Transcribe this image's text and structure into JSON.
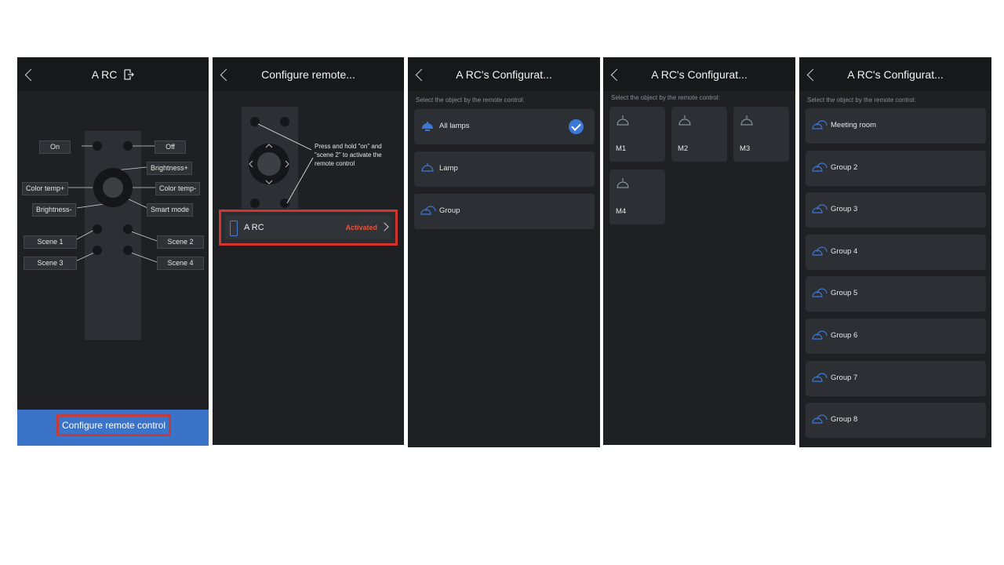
{
  "colors": {
    "accent": "#3a73c7",
    "highlight": "#d3352e",
    "activated": "#e4553e",
    "background": "#1e2023"
  },
  "screen1": {
    "title": "A RC",
    "title_icon": "exit-icon",
    "labels": {
      "on": "On",
      "off": "Off",
      "brightness_up": "Brightness+",
      "color_temp_up": "Color temp+",
      "color_temp_down": "Color temp-",
      "brightness_down": "Brightness-",
      "smart_mode": "Smart mode",
      "scene1": "Scene 1",
      "scene2": "Scene 2",
      "scene3": "Scene 3",
      "scene4": "Scene 4"
    },
    "configure_button": "Configure remote control"
  },
  "screen2": {
    "title": "Configure remote...",
    "instruction": "Press and hold \"on\" and \"scene 2\" to activate the remote control",
    "device": {
      "name": "A RC",
      "status": "Activated"
    }
  },
  "screen3": {
    "title": "A RC's Configurat...",
    "hint": "Select the object by the remote control:",
    "items": [
      {
        "label": "All lamps",
        "icon": "lamp-filled-icon",
        "checked": true
      },
      {
        "label": "Lamp",
        "icon": "lamp-icon"
      },
      {
        "label": "Group",
        "icon": "group-icon"
      }
    ]
  },
  "screen4": {
    "title": "A RC's Configurat...",
    "hint": "Select the object by the remote control:",
    "tiles": [
      {
        "label": "M1",
        "icon": "pendant-lamp-icon"
      },
      {
        "label": "M2",
        "icon": "pendant-lamp-icon"
      },
      {
        "label": "M3",
        "icon": "pendant-lamp-icon"
      },
      {
        "label": "M4",
        "icon": "pendant-lamp-icon"
      }
    ]
  },
  "screen5": {
    "title": "A RC's Configurat...",
    "hint": "Select the object by the remote control:",
    "groups": [
      {
        "label": "Meeting room"
      },
      {
        "label": "Group 2"
      },
      {
        "label": "Group 3"
      },
      {
        "label": "Group 4"
      },
      {
        "label": "Group 5"
      },
      {
        "label": "Group 6"
      },
      {
        "label": "Group 7"
      },
      {
        "label": "Group 8"
      }
    ]
  }
}
